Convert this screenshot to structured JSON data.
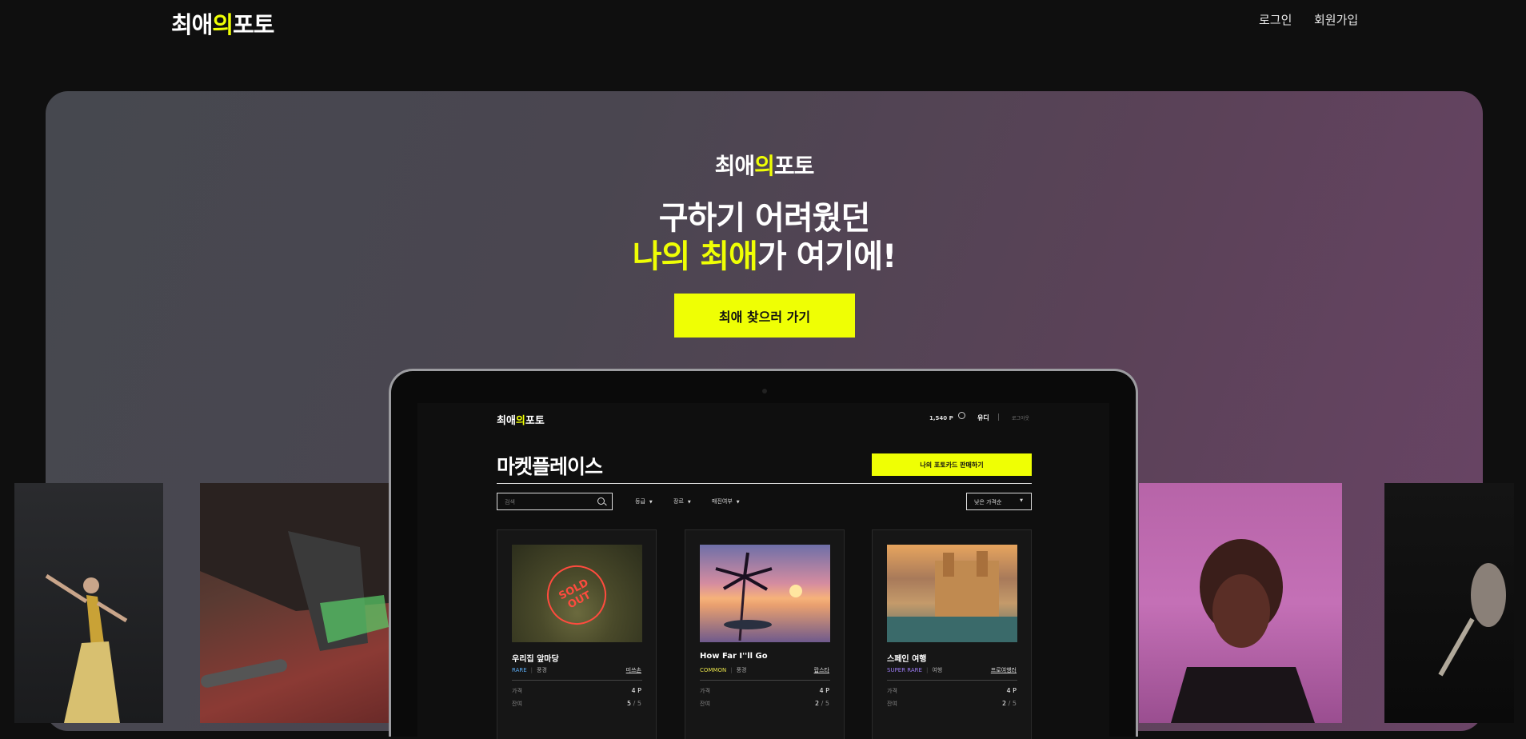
{
  "brand": {
    "part1": "최애",
    "part2": "의",
    "part3": "포토",
    "accent": "#efff04"
  },
  "nav": {
    "login": "로그인",
    "signup": "회원가입"
  },
  "hero": {
    "line1": "구하기 어려웠던",
    "line2_highlight": "나의 최애",
    "line2_rest": "가 여기에!",
    "cta": "최애 찾으러 가기"
  },
  "marketplace": {
    "points": "1,540 P",
    "user": "유디",
    "logout": "로그아웃",
    "title": "마켓플레이스",
    "sell_button": "나의 포토카드 판매하기",
    "search_placeholder": "검색",
    "filters": [
      "등급",
      "장르",
      "매진여부"
    ],
    "sort": "낮은 가격순",
    "cards": [
      {
        "name": "우리집 앞마당",
        "grade": "RARE",
        "genre": "풍경",
        "owner": "미쓰손",
        "price_label": "가격",
        "price": "4 P",
        "remain_label": "잔여",
        "remain": "5",
        "total": "/ 5",
        "sold_out": "SOLD OUT"
      },
      {
        "name": "How Far I''ll Go",
        "grade": "COMMON",
        "genre": "풍경",
        "owner": "랍스타",
        "price_label": "가격",
        "price": "4 P",
        "remain_label": "잔여",
        "remain": "2",
        "total": "/ 5"
      },
      {
        "name": "스페인 여행",
        "grade": "SUPER RARE",
        "genre": "여행",
        "owner": "프로여행러",
        "price_label": "가격",
        "price": "4 P",
        "remain_label": "잔여",
        "remain": "2",
        "total": "/ 5"
      }
    ]
  }
}
